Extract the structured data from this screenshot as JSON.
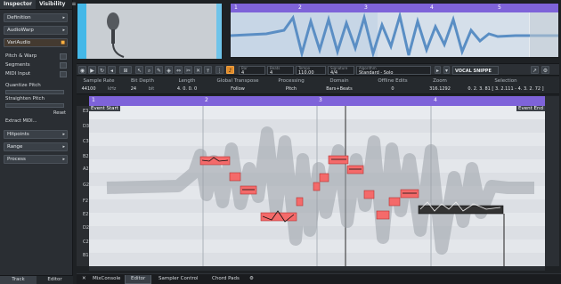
{
  "inspector": {
    "tabs": [
      "Inspector",
      "Visibility"
    ],
    "menu_icon": "hamburger-icon",
    "sections": [
      {
        "label": "Definition"
      },
      {
        "label": "AudioWarp"
      },
      {
        "label": "VariAudio"
      }
    ],
    "rows": [
      "Pitch & Warp",
      "Segments",
      "MIDI Input"
    ],
    "quantize_label": "Quantize Pitch",
    "straighten_label": "Straighten Pitch",
    "reset_label": "Reset",
    "extract_label": "Extract MIDI...",
    "lower_sections": [
      {
        "label": "Hitpoints"
      },
      {
        "label": "Range"
      },
      {
        "label": "Process"
      }
    ],
    "bottom_tabs": [
      "Track",
      "Editor"
    ]
  },
  "overview": {
    "bar_numbers": [
      "1",
      "2",
      "3",
      "4",
      "5"
    ]
  },
  "toolbar": {
    "fields": [
      {
        "label": "Bar",
        "value": "4"
      },
      {
        "label": "Beats",
        "value": "4"
      },
      {
        "label": "Tempo",
        "value": "110.00"
      },
      {
        "label": "Signature",
        "value": "4/4"
      },
      {
        "label": "Algorithm",
        "value": "Standard - Solo"
      }
    ],
    "sample_name": "VOCAL SNIPPE"
  },
  "info_line": {
    "columns": [
      {
        "header": "Sample Rate",
        "value": "44100",
        "unit": "kHz"
      },
      {
        "header": "Bit Depth",
        "value": "24",
        "unit": "bit"
      },
      {
        "header": "Length",
        "value": "4. 0. 0. 0"
      },
      {
        "header": "Global Transpose",
        "value": "Follow"
      },
      {
        "header": "Processing",
        "value": "Pitch"
      },
      {
        "header": "Domain",
        "value": "Bars+Beats"
      },
      {
        "header": "Offline Edits",
        "value": "0"
      },
      {
        "header": "Zoom",
        "value": "316.1292"
      },
      {
        "header": "Selection",
        "value": "0. 2. 3. 81 [ 3. 2.111 - 4. 3. 2. 72 ]"
      }
    ]
  },
  "editor": {
    "bar_numbers": [
      "1",
      "2",
      "3",
      "4"
    ],
    "event_start": "Event Start",
    "event_end": "Event End",
    "key_labels": [
      "E3",
      "D3",
      "C3",
      "B2",
      "A2",
      "G2",
      "F2",
      "E2",
      "D2",
      "C2",
      "B1"
    ],
    "current_key": "5"
  },
  "bottom_bar": {
    "close_icon": "close-icon",
    "tabs": [
      "MixConsole",
      "Editor",
      "Sampler Control",
      "Chord Pads"
    ],
    "settings_icon": "gear-icon"
  },
  "colors": {
    "ruler": "#7e63d9",
    "segment_red": "#f46a6a",
    "waveform_overview": "#5b8fc4",
    "accent_orange": "#e08b2a"
  }
}
